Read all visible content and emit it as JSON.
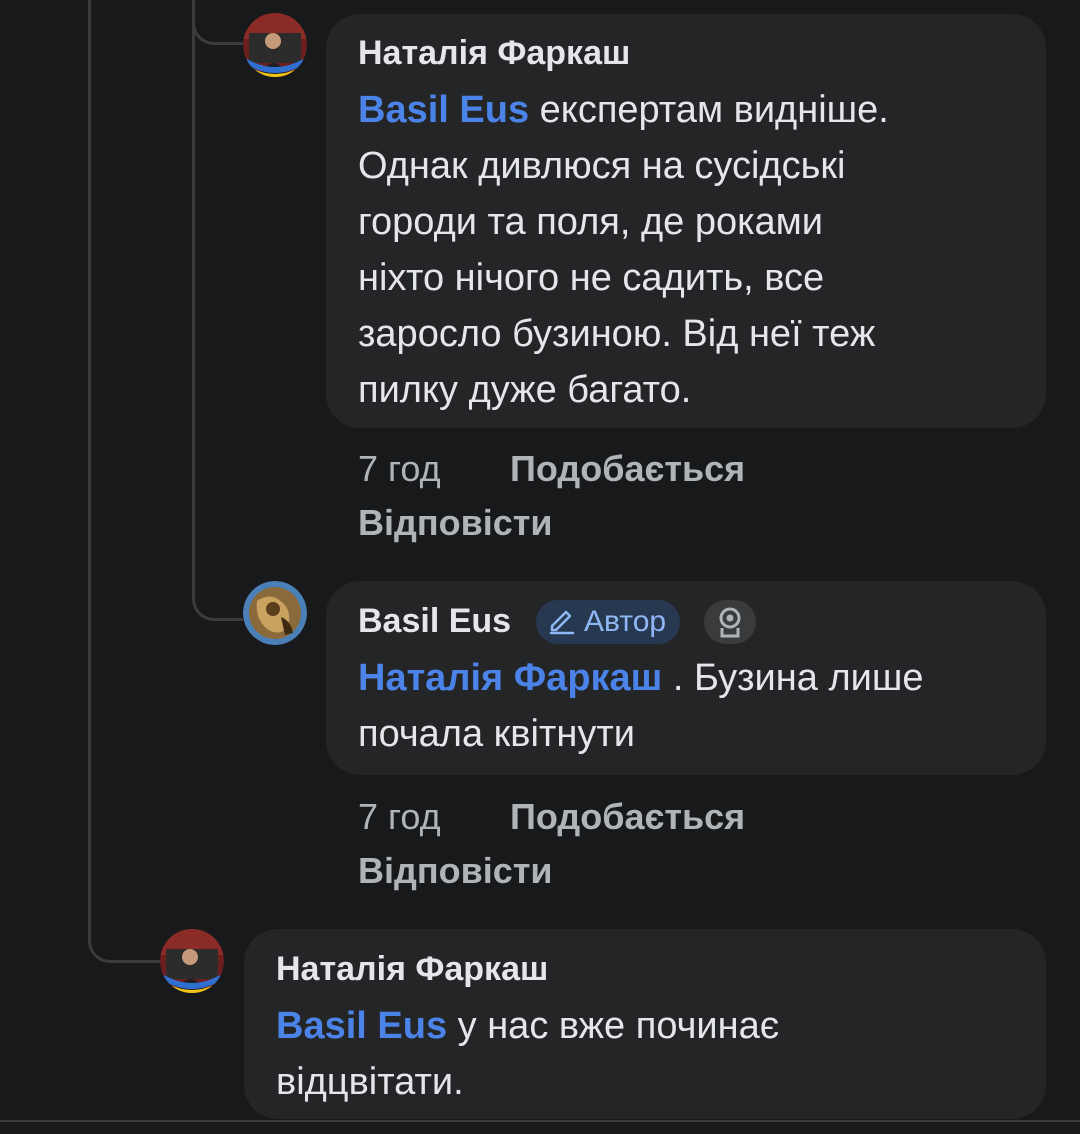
{
  "comments": [
    {
      "author": "Наталія Фаркаш",
      "mention": "Basil Eus",
      "text_lines": [
        " експертам видніше.",
        "Однак дивлюся на сусідські",
        "городи та поля, де роками",
        "ніхто нічого не садить, все",
        "заросло бузиною. Від неї теж",
        "пилку дуже багато."
      ],
      "time": "7 год",
      "like_label": "Подобається",
      "reply_label": "Відповісти"
    },
    {
      "author": "Basil Eus",
      "author_badge": "Автор",
      "badge_icon": "award-icon",
      "mention": "Наталія Фаркаш",
      "text_lines": [
        " . Бузина лише",
        "почала квітнути"
      ],
      "time": "7 год",
      "like_label": "Подобається",
      "reply_label": "Відповісти"
    },
    {
      "author": "Наталія Фаркаш",
      "mention": "Basil Eus",
      "text_lines": [
        " у нас вже починає",
        "відцвітати."
      ]
    }
  ],
  "colors": {
    "background": "#18191a",
    "bubble": "#242526",
    "mention": "#4b83e8",
    "meta": "#b0b3b8",
    "badge_text": "#8fb6f5"
  }
}
